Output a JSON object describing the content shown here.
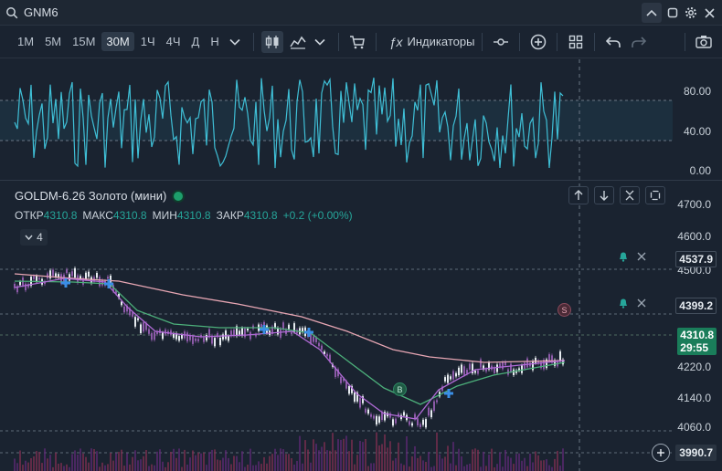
{
  "topbar": {
    "symbol": "GNM6"
  },
  "toolbar": {
    "timeframes": [
      "1М",
      "5М",
      "15М",
      "30М",
      "1Ч",
      "4Ч",
      "Д",
      "Н"
    ],
    "active_timeframe": "30М",
    "indicators_label": "Индикаторы"
  },
  "oscillator": {
    "axis_labels": [
      "80.00",
      "40.00",
      "0.00"
    ]
  },
  "legend": {
    "title": "GOLDM-6.26 Золото (мини)",
    "open_label": "ОТКР",
    "open": "4310.8",
    "high_label": "МАКС",
    "high": "4310.8",
    "low_label": "МИН",
    "low": "4310.8",
    "close_label": "ЗАКР",
    "close": "4310.8",
    "change": "+0.2 (+0.00%)",
    "collapsed_count": "4"
  },
  "price_axis": {
    "labels": [
      "4700.0",
      "4600.0",
      "4500.0",
      "4220.0",
      "4140.0",
      "4060.0"
    ],
    "alert_price_1": "4537.9",
    "alert_price_2": "4399.2",
    "last_price": "4310.8",
    "countdown": "29:55",
    "crosshair_price": "3990.7"
  },
  "markers": {
    "sell": "S",
    "buy": "B"
  },
  "colors": {
    "accent_green": "#26a69a",
    "osc_line": "#3fbfd6",
    "ma_pink": "#e7a6b3",
    "ma_green": "#4caf7a",
    "ma_purple": "#b06ad6",
    "price_tag": "#1a7d5a"
  }
}
